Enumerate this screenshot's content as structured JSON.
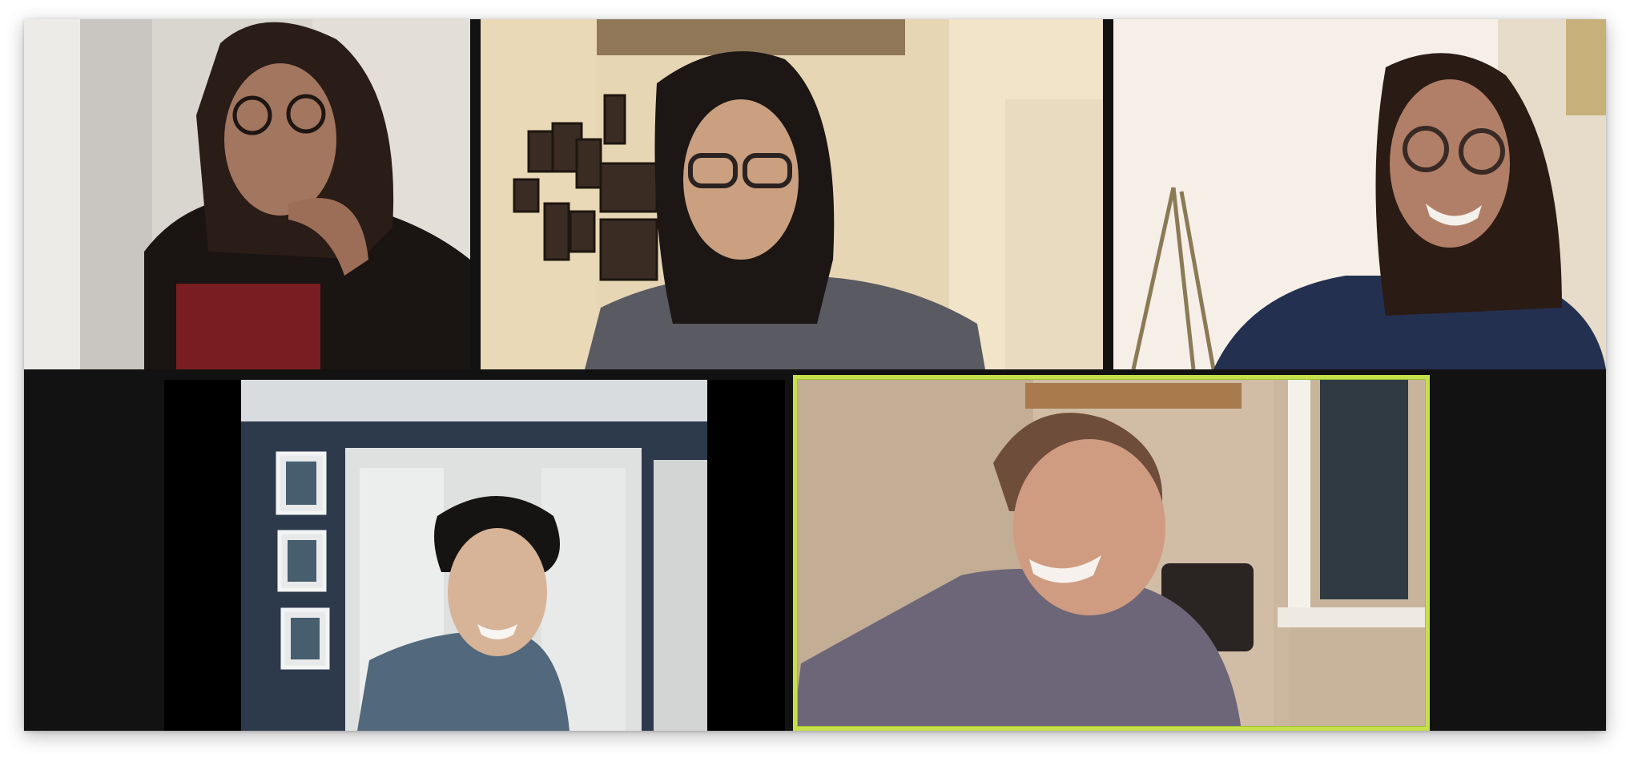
{
  "meeting": {
    "view": "gallery",
    "participant_count": 5,
    "active_speaker_index": 4,
    "accent_color": "#c6e04a",
    "background_color": "#121212"
  },
  "participants": [
    {
      "id": "p1",
      "name": "",
      "position": "top-left"
    },
    {
      "id": "p2",
      "name": "",
      "position": "top-center"
    },
    {
      "id": "p3",
      "name": "",
      "position": "top-right"
    },
    {
      "id": "p4",
      "name": "",
      "position": "bottom-left"
    },
    {
      "id": "p5",
      "name": "",
      "position": "bottom-right",
      "active_speaker": true
    }
  ]
}
